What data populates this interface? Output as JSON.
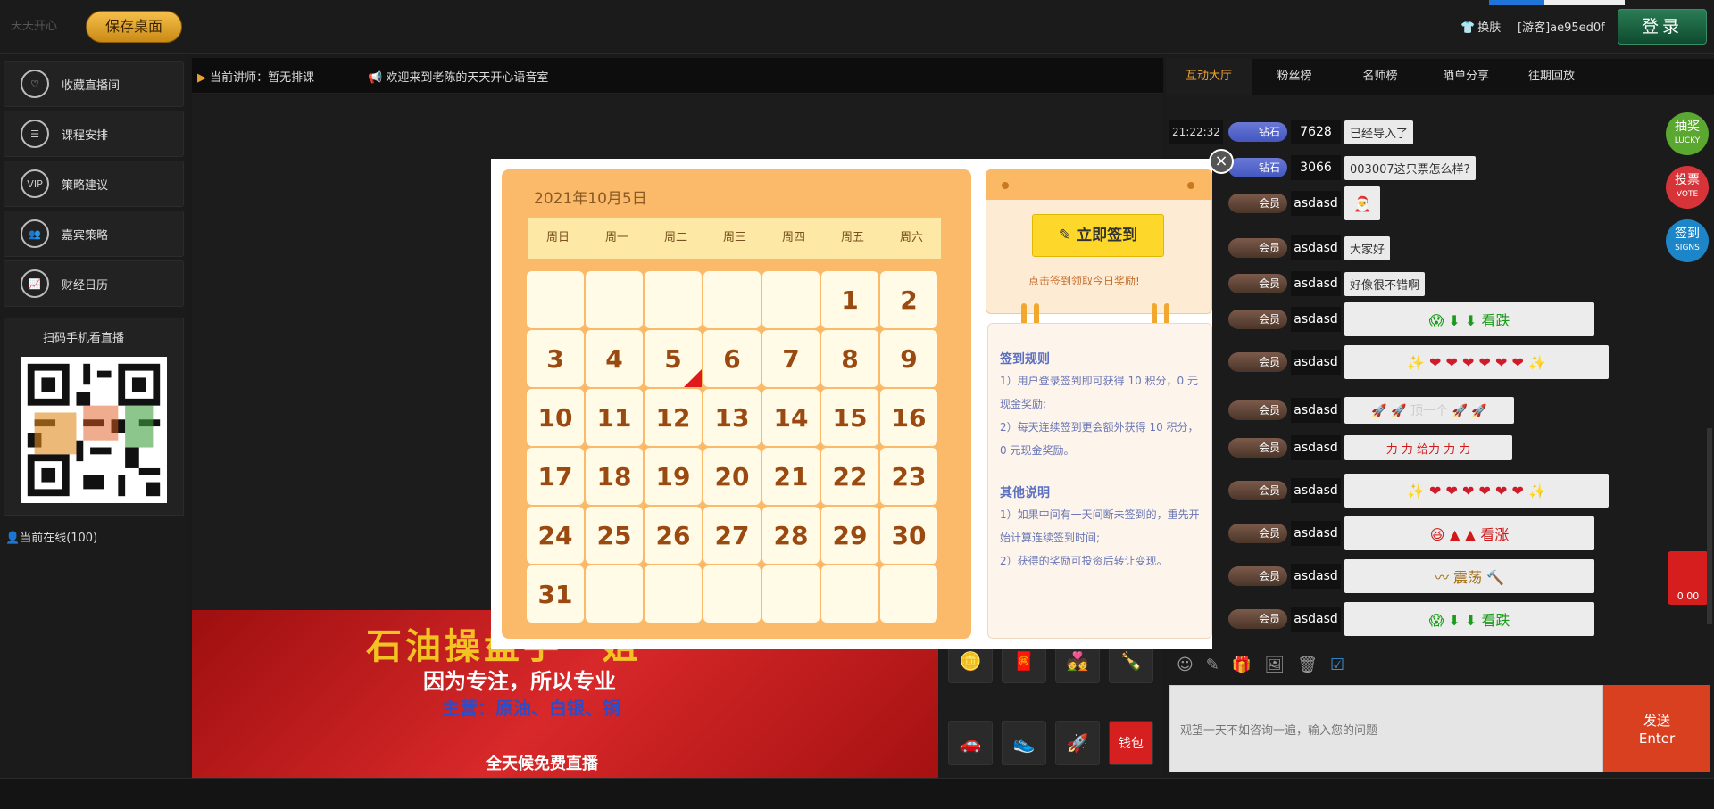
{
  "top": {
    "logo_text": "天天开心",
    "save_label": "保存桌面",
    "skin_label": "换肤",
    "guest_label": "[游客]ae95ed0f",
    "login_label": "登录"
  },
  "sidebar": {
    "items": [
      {
        "label": "收藏直播间",
        "icon": "heart-icon"
      },
      {
        "label": "课程安排",
        "icon": "schedule-icon"
      },
      {
        "label": "策略建议",
        "icon": "vip-icon"
      },
      {
        "label": "嘉宾策略",
        "icon": "guests-icon"
      },
      {
        "label": "财经日历",
        "icon": "chart-icon"
      }
    ],
    "qr_title": "扫码手机看直播",
    "online": "当前在线(100)"
  },
  "notice": {
    "teacher": "当前讲师：暂无排课",
    "welcome": "欢迎来到老陈的天天开心语音室"
  },
  "banner": {
    "line1": "石油操盘手一姐",
    "line2": "因为专注，所以专业",
    "line3": "主营：原油、白银、铜",
    "line4": "全天候免费直播"
  },
  "gifts": {
    "wallet_label": "钱包"
  },
  "tabs": [
    "互动大厅",
    "粉丝榜",
    "名师榜",
    "晒单分享",
    "往期回放"
  ],
  "chat": {
    "messages": [
      {
        "time": "21:22:32",
        "badge": "钻石",
        "user": "7628",
        "text": "已经导入了"
      },
      {
        "time": "",
        "badge": "钻石",
        "user": "3066",
        "text": "003007这只票怎么样?"
      },
      {
        "time": "",
        "badge": "会员",
        "user": "asdasd",
        "text": "",
        "sticker": "🎅"
      },
      {
        "time": "",
        "badge": "会员",
        "user": "asdasd",
        "text": "大家好"
      },
      {
        "time": "",
        "badge": "会员",
        "user": "asdasd",
        "text": "好像很不错啊"
      },
      {
        "time": "",
        "badge": "会员",
        "user": "asdasd",
        "text": "",
        "sticker": "😱 ⬇ ⬇ 看跌"
      },
      {
        "time": "",
        "badge": "会员",
        "user": "asdasd",
        "text": "",
        "sticker": "✨ ❤ ❤ ❤ ❤ ❤ ❤ ✨"
      },
      {
        "time": "",
        "badge": "会员",
        "user": "asdasd",
        "text": "",
        "sticker": "🚀 🚀 顶一个 🚀 🚀"
      },
      {
        "time": "",
        "badge": "会员",
        "user": "asdasd",
        "text": "",
        "sticker": "力 力 给力 力 力"
      },
      {
        "time": "",
        "badge": "会员",
        "user": "asdasd",
        "text": "",
        "sticker": "✨ ❤ ❤ ❤ ❤ ❤ ❤ ✨"
      },
      {
        "time": "",
        "badge": "会员",
        "user": "asdasd",
        "text": "",
        "sticker": "😆 ▲ ▲ 看涨"
      },
      {
        "time": "",
        "badge": "会员",
        "user": "asdasd",
        "text": "",
        "sticker": "〰 震荡 🔨"
      },
      {
        "time": "",
        "badge": "会员",
        "user": "asdasd",
        "text": "",
        "sticker": "😱 ⬇ ⬇ 看跌"
      }
    ],
    "input_placeholder": "观望一天不如咨询一遍，输入您的问题",
    "send_label": "发送",
    "send_sub": "Enter"
  },
  "side_buttons": [
    {
      "label": "抽奖",
      "sub": "LUCKY",
      "color": "#5aa830"
    },
    {
      "label": "投票",
      "sub": "VOTE",
      "color": "#d7343a"
    },
    {
      "label": "签到",
      "sub": "SIGNS",
      "color": "#1d86c8"
    }
  ],
  "redpack_amount": "0.00",
  "modal": {
    "date": "2021年10月5日",
    "weekdays": [
      "周日",
      "周一",
      "周二",
      "周三",
      "周四",
      "周五",
      "周六"
    ],
    "days": [
      "",
      "",
      "",
      "",
      "",
      "1",
      "2",
      "3",
      "4",
      "5",
      "6",
      "7",
      "8",
      "9",
      "10",
      "11",
      "12",
      "13",
      "14",
      "15",
      "16",
      "17",
      "18",
      "19",
      "20",
      "21",
      "22",
      "23",
      "24",
      "25",
      "26",
      "27",
      "28",
      "29",
      "30",
      "31",
      "",
      "",
      "",
      "",
      "",
      ""
    ],
    "sign_button": "立即签到",
    "sign_hint": "点击签到领取今日奖励!",
    "rules_title": "签到规则",
    "rule1": "1）用户登录签到即可获得 10 积分，0 元现金奖励;",
    "rule2": "2）每天连续签到更会额外获得 10 积分，0 元现金奖励。",
    "other_title": "其他说明",
    "other1": "1）如果中间有一天间断未签到的，重先开始计算连续签到时间;",
    "other2": "2）获得的奖励可投资后转让变现。"
  }
}
